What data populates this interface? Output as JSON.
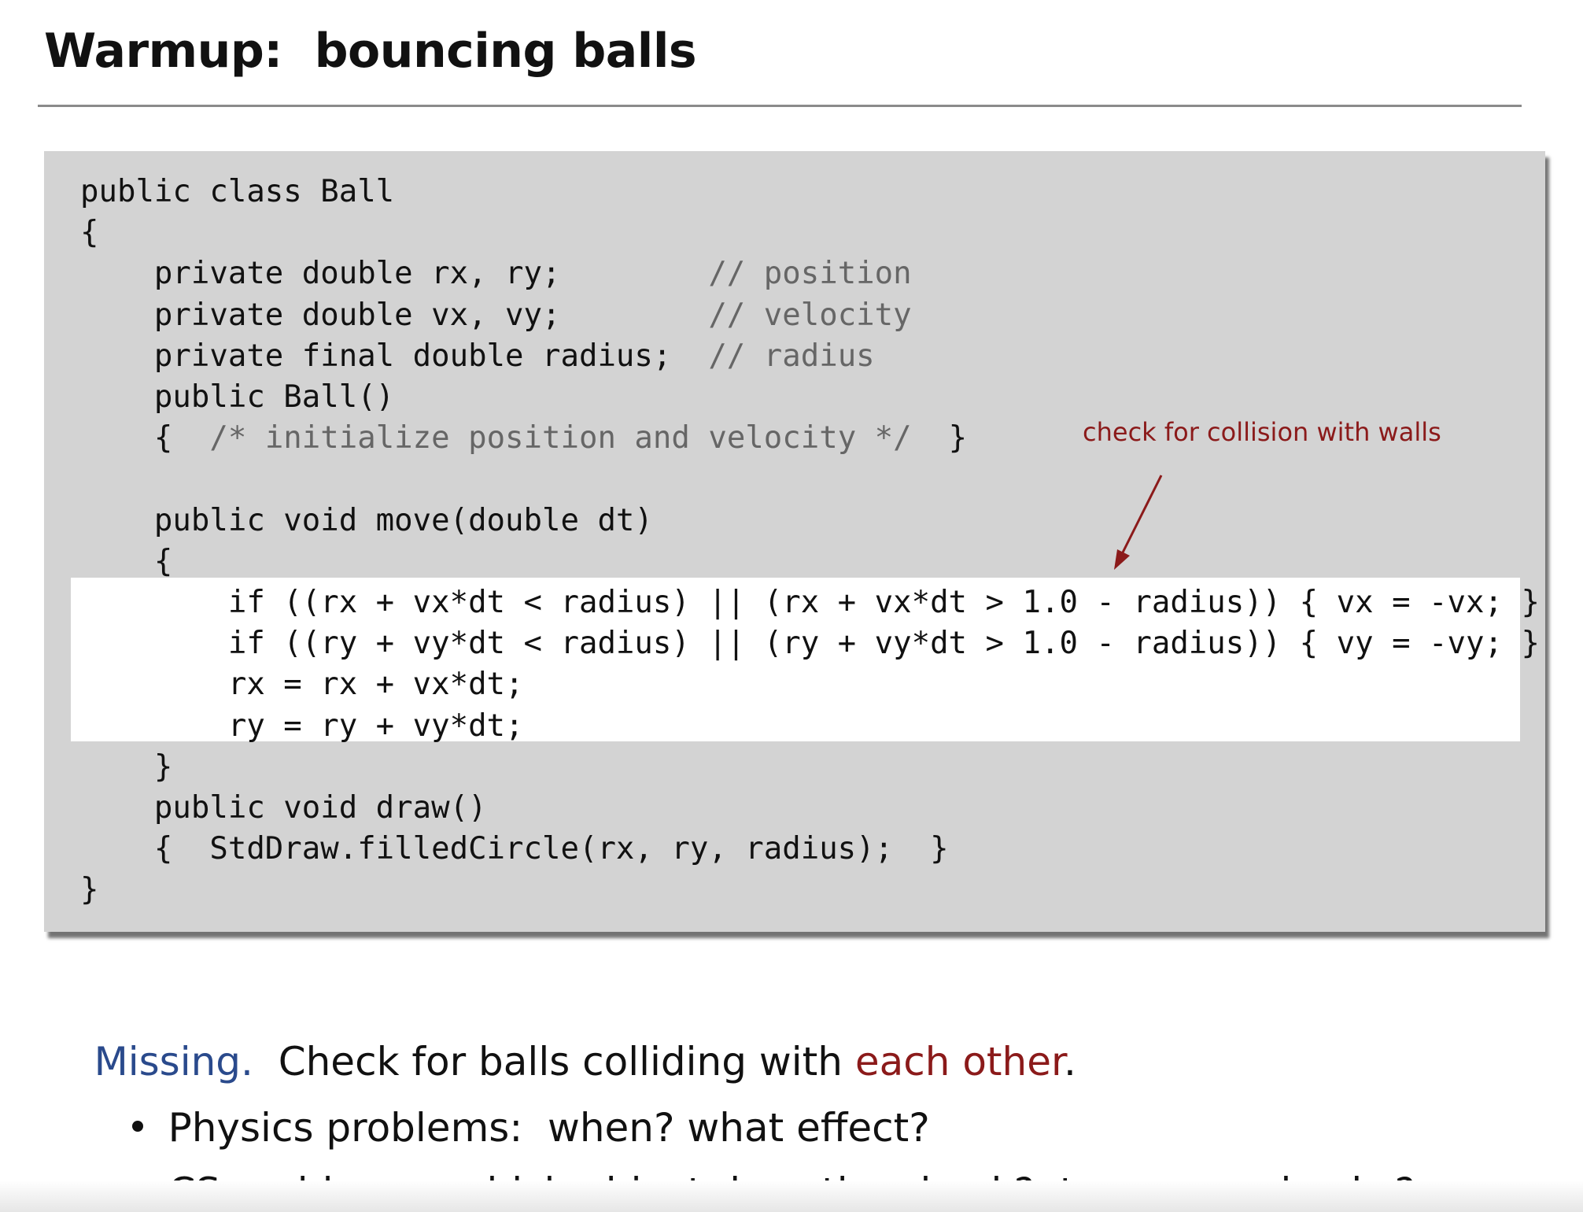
{
  "slide": {
    "title": "Warmup:  bouncing balls",
    "code_lines": [
      {
        "code": "public class Ball",
        "comment": ""
      },
      {
        "code": "{",
        "comment": ""
      },
      {
        "code": "    private double rx, ry;        ",
        "comment": "// position"
      },
      {
        "code": "    private double vx, vy;        ",
        "comment": "// velocity"
      },
      {
        "code": "    private final double radius;  ",
        "comment": "// radius"
      },
      {
        "code": "    public Ball()",
        "comment": ""
      },
      {
        "code": "    {  ",
        "comment": "/* initialize position and velocity */",
        "tail": "  }"
      },
      {
        "code": "",
        "comment": ""
      },
      {
        "code": "    public void move(double dt)",
        "comment": ""
      },
      {
        "code": "    {",
        "comment": ""
      },
      {
        "code": "        if ((rx + vx*dt < radius) || (rx + vx*dt > 1.0 - radius)) { vx = -vx; }",
        "comment": ""
      },
      {
        "code": "        if ((ry + vy*dt < radius) || (ry + vy*dt > 1.0 - radius)) { vy = -vy; }",
        "comment": ""
      },
      {
        "code": "        rx = rx + vx*dt;",
        "comment": ""
      },
      {
        "code": "        ry = ry + vy*dt;",
        "comment": ""
      },
      {
        "code": "    }",
        "comment": ""
      },
      {
        "code": "    public void draw()",
        "comment": ""
      },
      {
        "code": "    {  StdDraw.filledCircle(rx, ry, radius);  }",
        "comment": ""
      },
      {
        "code": "}",
        "comment": ""
      }
    ],
    "annotation": "check for collision with walls",
    "missing": {
      "label": "Missing.",
      "text_before": "  Check for balls colliding with ",
      "emphasis": "each other",
      "text_after": "."
    },
    "bullets": [
      "Physics problems:  when? what effect?",
      "CS problems:  which object does the check?  too many checks?"
    ],
    "colors": {
      "panel_bg": "#d3d3d3",
      "highlight_bg": "#ffffff",
      "comment": "#666666",
      "annotation": "#8b1a1a",
      "missing_label": "#2a4a8c",
      "emphasis": "#8b1a1a"
    }
  }
}
